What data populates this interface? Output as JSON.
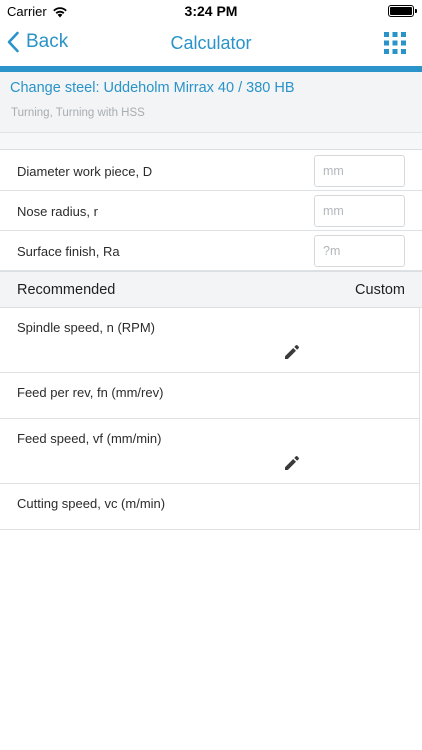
{
  "status_bar": {
    "carrier": "Carrier",
    "time": "3:24 PM"
  },
  "nav": {
    "back_label": "Back",
    "title": "Calculator",
    "menu_icon": "grid-icon"
  },
  "colors": {
    "accent": "#2a93c9",
    "header_bg": "#f2f4f5"
  },
  "steel": {
    "title": "Change steel: Uddeholm Mirrax 40 / 380 HB",
    "subtitle": "Turning, Turning with HSS"
  },
  "inputs": [
    {
      "label": "Diameter work piece, D",
      "placeholder": "mm",
      "value": ""
    },
    {
      "label": "Nose radius, r",
      "placeholder": "mm",
      "value": ""
    },
    {
      "label": "Surface finish, Ra",
      "placeholder": "?m",
      "value": ""
    }
  ],
  "section": {
    "left": "Recommended",
    "right": "Custom"
  },
  "results": [
    {
      "label": "Spindle speed, n (RPM)",
      "editable": true
    },
    {
      "label": "Feed per rev, fn (mm/rev)",
      "editable": false
    },
    {
      "label": "Feed speed, vf (mm/min)",
      "editable": true
    },
    {
      "label": "Cutting speed, vc (m/min)",
      "editable": false
    }
  ]
}
